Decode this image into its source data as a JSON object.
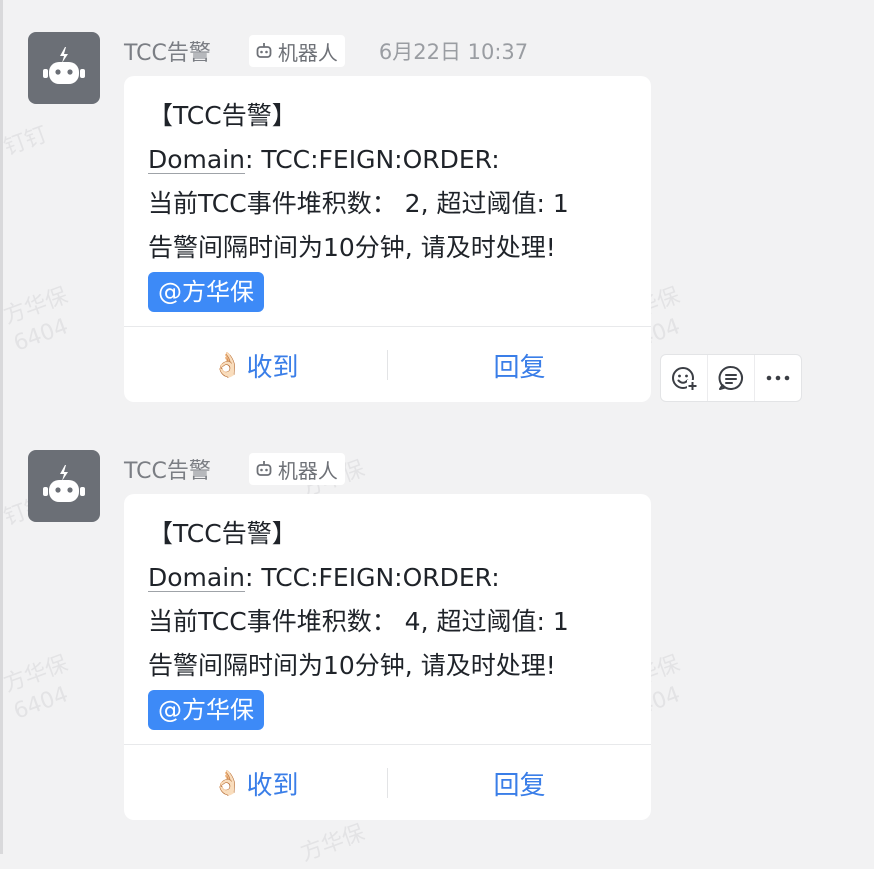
{
  "watermark": {
    "lines": [
      "钉钉",
      "方华保\n6404"
    ]
  },
  "messages": [
    {
      "sender": "TCC告警",
      "robot_label": "机器人",
      "time": "6月22日 10:37",
      "title": "【TCC告警】",
      "domain_label": "Domain",
      "domain_value": ": TCC:FEIGN:ORDER:",
      "line3": "当前TCC事件堆积数： 2, 超过阈值: 1",
      "line4": "告警间隔时间为10分钟, 请及时处理!",
      "mention": "@方华保",
      "ack_icon": "👌🏻",
      "ack_label": "收到",
      "reply_label": "回复"
    },
    {
      "sender": "TCC告警",
      "robot_label": "机器人",
      "time": "",
      "title": "【TCC告警】",
      "domain_label": "Domain",
      "domain_value": ": TCC:FEIGN:ORDER:",
      "line3": "当前TCC事件堆积数： 4, 超过阈值: 1",
      "line4": "告警间隔时间为10分钟, 请及时处理!",
      "mention": "@方华保",
      "ack_icon": "👌🏻",
      "ack_label": "收到",
      "reply_label": "回复"
    }
  ],
  "hover_toolbar": {
    "icons": [
      "emoji-add-icon",
      "comment-icon",
      "more-icon"
    ]
  },
  "colors": {
    "accent": "#3a7ee8",
    "mention_bg": "#3d8af7",
    "avatar_bg": "#6b6f76",
    "page_bg": "#f2f2f3"
  }
}
